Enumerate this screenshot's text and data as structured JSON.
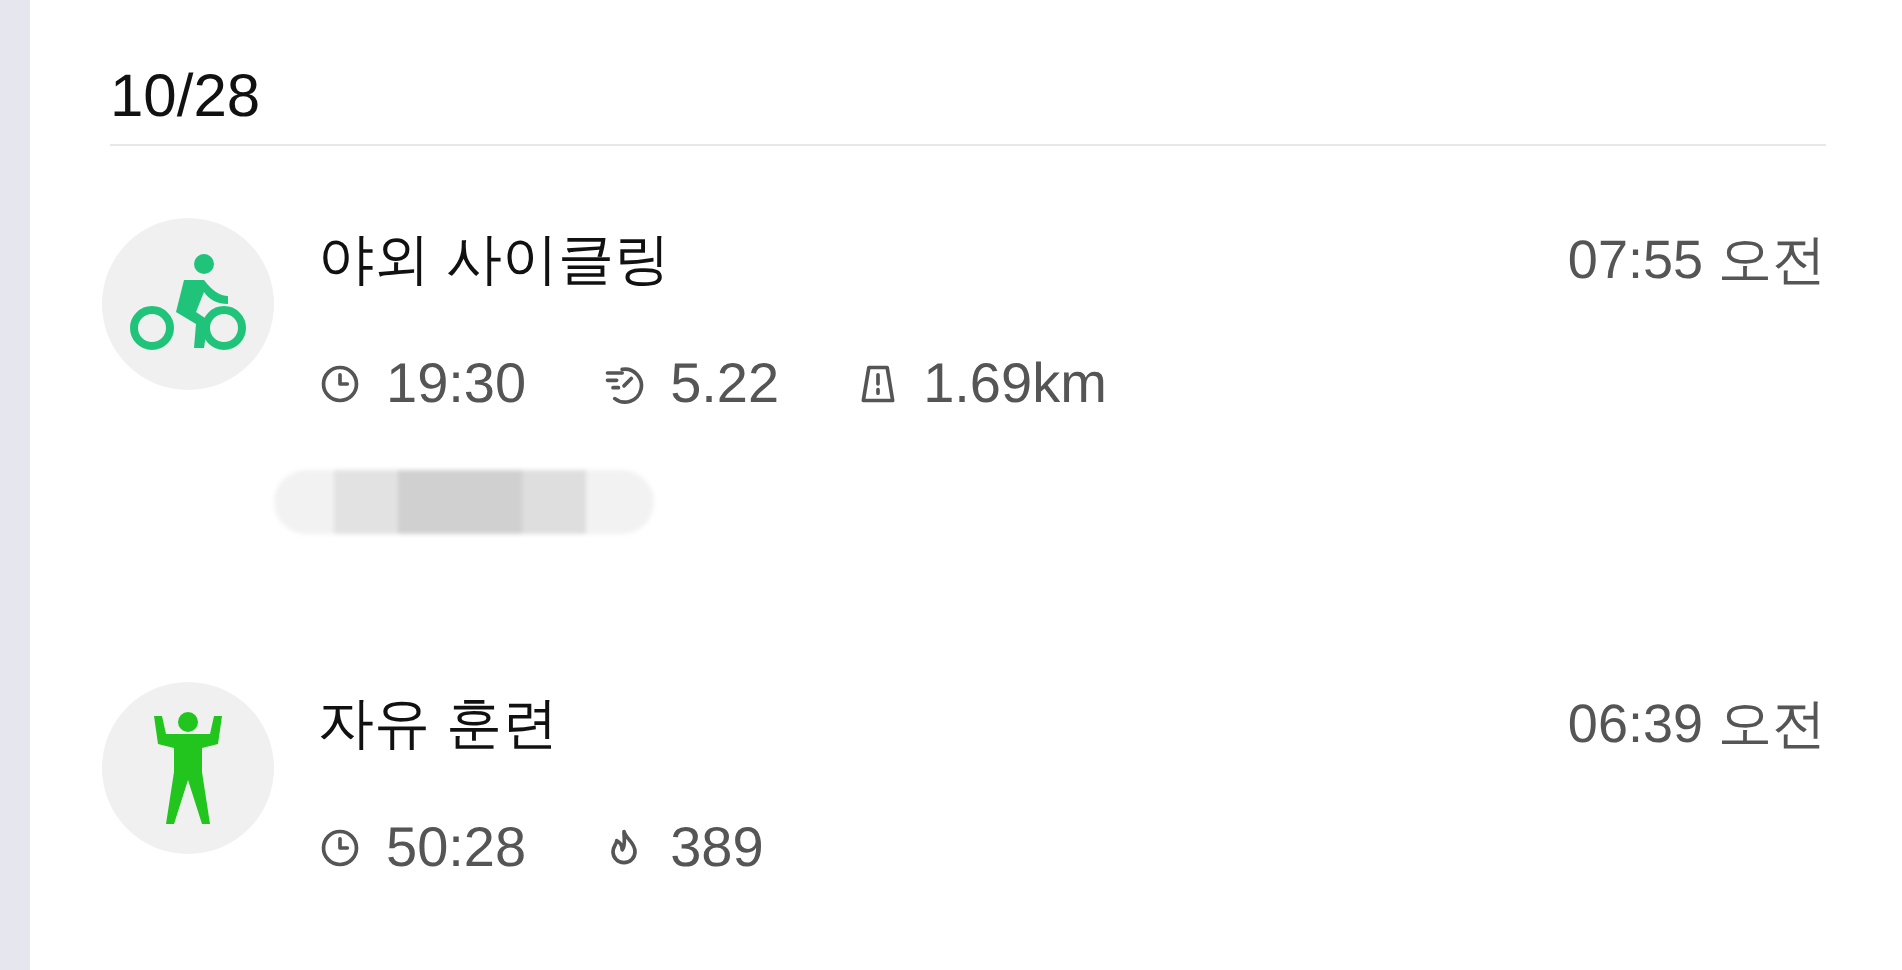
{
  "date": "10/28",
  "activities": [
    {
      "kind": "cycling",
      "color": "#1fc37a",
      "title": "야외 사이클링",
      "time": "07:55 오전",
      "metrics": [
        {
          "kind": "duration",
          "value": "19:30"
        },
        {
          "kind": "pace",
          "value": "5.22"
        },
        {
          "kind": "distance",
          "value": "1.69km"
        }
      ],
      "attachment": {
        "kind": "blurred"
      }
    },
    {
      "kind": "workout",
      "color": "#22c51e",
      "title": "자유 훈련",
      "time": "06:39 오전",
      "metrics": [
        {
          "kind": "duration",
          "value": "50:28"
        },
        {
          "kind": "calories",
          "value": "389"
        }
      ]
    }
  ]
}
